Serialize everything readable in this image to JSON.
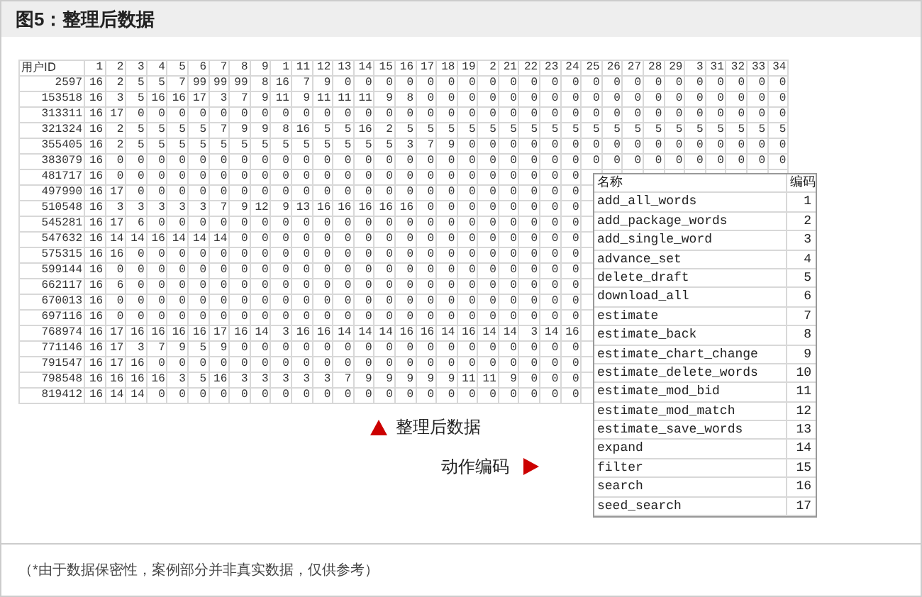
{
  "figure": {
    "title": "图5：整理后数据"
  },
  "table": {
    "columns": [
      "用户ID",
      "1",
      "2",
      "3",
      "4",
      "5",
      "6",
      "7",
      "8",
      "9",
      "1",
      "11",
      "12",
      "13",
      "14",
      "15",
      "16",
      "17",
      "18",
      "19",
      "2",
      "21",
      "22",
      "23",
      "24",
      "25",
      "26",
      "27",
      "28",
      "29",
      "3",
      "31",
      "32",
      "33",
      "34"
    ],
    "rows": [
      {
        "id": "2597",
        "values": [
          "16",
          "2",
          "5",
          "5",
          "7",
          "99",
          "99",
          "99",
          "8",
          "16",
          "7",
          "9",
          "0",
          "0",
          "0",
          "0",
          "0",
          "0",
          "0",
          "0",
          "0",
          "0",
          "0",
          "0",
          "0",
          "0",
          "0",
          "0",
          "0",
          "0",
          "0",
          "0",
          "0",
          "0"
        ]
      },
      {
        "id": "153518",
        "values": [
          "16",
          "3",
          "5",
          "16",
          "16",
          "17",
          "3",
          "7",
          "9",
          "11",
          "9",
          "11",
          "11",
          "11",
          "9",
          "8",
          "0",
          "0",
          "0",
          "0",
          "0",
          "0",
          "0",
          "0",
          "0",
          "0",
          "0",
          "0",
          "0",
          "0",
          "0",
          "0",
          "0",
          "0"
        ]
      },
      {
        "id": "313311",
        "values": [
          "16",
          "17",
          "0",
          "0",
          "0",
          "0",
          "0",
          "0",
          "0",
          "0",
          "0",
          "0",
          "0",
          "0",
          "0",
          "0",
          "0",
          "0",
          "0",
          "0",
          "0",
          "0",
          "0",
          "0",
          "0",
          "0",
          "0",
          "0",
          "0",
          "0",
          "0",
          "0",
          "0",
          "0"
        ]
      },
      {
        "id": "321324",
        "values": [
          "16",
          "2",
          "5",
          "5",
          "5",
          "5",
          "7",
          "9",
          "9",
          "8",
          "16",
          "5",
          "5",
          "16",
          "2",
          "5",
          "5",
          "5",
          "5",
          "5",
          "5",
          "5",
          "5",
          "5",
          "5",
          "5",
          "5",
          "5",
          "5",
          "5",
          "5",
          "5",
          "5",
          "5"
        ]
      },
      {
        "id": "355405",
        "values": [
          "16",
          "2",
          "5",
          "5",
          "5",
          "5",
          "5",
          "5",
          "5",
          "5",
          "5",
          "5",
          "5",
          "5",
          "5",
          "3",
          "7",
          "9",
          "0",
          "0",
          "0",
          "0",
          "0",
          "0",
          "0",
          "0",
          "0",
          "0",
          "0",
          "0",
          "0",
          "0",
          "0",
          "0"
        ]
      },
      {
        "id": "383079",
        "values": [
          "16",
          "0",
          "0",
          "0",
          "0",
          "0",
          "0",
          "0",
          "0",
          "0",
          "0",
          "0",
          "0",
          "0",
          "0",
          "0",
          "0",
          "0",
          "0",
          "0",
          "0",
          "0",
          "0",
          "0",
          "0",
          "0",
          "0",
          "0",
          "0",
          "0",
          "0",
          "0",
          "0",
          "0"
        ]
      },
      {
        "id": "481717",
        "values": [
          "16",
          "0",
          "0",
          "0",
          "0",
          "0",
          "0",
          "0",
          "0",
          "0",
          "0",
          "0",
          "0",
          "0",
          "0",
          "0",
          "0",
          "0",
          "0",
          "0",
          "0",
          "0",
          "0",
          "0"
        ]
      },
      {
        "id": "497990",
        "values": [
          "16",
          "17",
          "0",
          "0",
          "0",
          "0",
          "0",
          "0",
          "0",
          "0",
          "0",
          "0",
          "0",
          "0",
          "0",
          "0",
          "0",
          "0",
          "0",
          "0",
          "0",
          "0",
          "0",
          "0"
        ]
      },
      {
        "id": "510548",
        "values": [
          "16",
          "3",
          "3",
          "3",
          "3",
          "3",
          "7",
          "9",
          "12",
          "9",
          "13",
          "16",
          "16",
          "16",
          "16",
          "16",
          "0",
          "0",
          "0",
          "0",
          "0",
          "0",
          "0",
          "0"
        ]
      },
      {
        "id": "545281",
        "values": [
          "16",
          "17",
          "6",
          "0",
          "0",
          "0",
          "0",
          "0",
          "0",
          "0",
          "0",
          "0",
          "0",
          "0",
          "0",
          "0",
          "0",
          "0",
          "0",
          "0",
          "0",
          "0",
          "0",
          "0"
        ]
      },
      {
        "id": "547632",
        "values": [
          "16",
          "14",
          "14",
          "16",
          "14",
          "14",
          "14",
          "0",
          "0",
          "0",
          "0",
          "0",
          "0",
          "0",
          "0",
          "0",
          "0",
          "0",
          "0",
          "0",
          "0",
          "0",
          "0",
          "0"
        ]
      },
      {
        "id": "575315",
        "values": [
          "16",
          "16",
          "0",
          "0",
          "0",
          "0",
          "0",
          "0",
          "0",
          "0",
          "0",
          "0",
          "0",
          "0",
          "0",
          "0",
          "0",
          "0",
          "0",
          "0",
          "0",
          "0",
          "0",
          "0"
        ]
      },
      {
        "id": "599144",
        "values": [
          "16",
          "0",
          "0",
          "0",
          "0",
          "0",
          "0",
          "0",
          "0",
          "0",
          "0",
          "0",
          "0",
          "0",
          "0",
          "0",
          "0",
          "0",
          "0",
          "0",
          "0",
          "0",
          "0",
          "0"
        ]
      },
      {
        "id": "662117",
        "values": [
          "16",
          "6",
          "0",
          "0",
          "0",
          "0",
          "0",
          "0",
          "0",
          "0",
          "0",
          "0",
          "0",
          "0",
          "0",
          "0",
          "0",
          "0",
          "0",
          "0",
          "0",
          "0",
          "0",
          "0"
        ]
      },
      {
        "id": "670013",
        "values": [
          "16",
          "0",
          "0",
          "0",
          "0",
          "0",
          "0",
          "0",
          "0",
          "0",
          "0",
          "0",
          "0",
          "0",
          "0",
          "0",
          "0",
          "0",
          "0",
          "0",
          "0",
          "0",
          "0",
          "0"
        ]
      },
      {
        "id": "697116",
        "values": [
          "16",
          "0",
          "0",
          "0",
          "0",
          "0",
          "0",
          "0",
          "0",
          "0",
          "0",
          "0",
          "0",
          "0",
          "0",
          "0",
          "0",
          "0",
          "0",
          "0",
          "0",
          "0",
          "0",
          "0"
        ]
      },
      {
        "id": "768974",
        "values": [
          "16",
          "17",
          "16",
          "16",
          "16",
          "16",
          "17",
          "16",
          "14",
          "3",
          "16",
          "16",
          "14",
          "14",
          "14",
          "16",
          "16",
          "14",
          "16",
          "14",
          "14",
          "3",
          "14",
          "16"
        ]
      },
      {
        "id": "771146",
        "values": [
          "16",
          "17",
          "3",
          "7",
          "9",
          "5",
          "9",
          "0",
          "0",
          "0",
          "0",
          "0",
          "0",
          "0",
          "0",
          "0",
          "0",
          "0",
          "0",
          "0",
          "0",
          "0",
          "0",
          "0"
        ]
      },
      {
        "id": "791547",
        "values": [
          "16",
          "17",
          "16",
          "0",
          "0",
          "0",
          "0",
          "0",
          "0",
          "0",
          "0",
          "0",
          "0",
          "0",
          "0",
          "0",
          "0",
          "0",
          "0",
          "0",
          "0",
          "0",
          "0",
          "0"
        ]
      },
      {
        "id": "798548",
        "values": [
          "16",
          "16",
          "16",
          "16",
          "3",
          "5",
          "16",
          "3",
          "3",
          "3",
          "3",
          "3",
          "7",
          "9",
          "9",
          "9",
          "9",
          "9",
          "11",
          "11",
          "9",
          "0",
          "0",
          "0"
        ]
      },
      {
        "id": "819412",
        "values": [
          "16",
          "14",
          "14",
          "0",
          "0",
          "0",
          "0",
          "0",
          "0",
          "0",
          "0",
          "0",
          "0",
          "0",
          "0",
          "0",
          "0",
          "0",
          "0",
          "0",
          "0",
          "0",
          "0",
          "0"
        ]
      }
    ]
  },
  "action_codes": {
    "columns": [
      "名称",
      "编码"
    ],
    "rows": [
      {
        "name": "add_all_words",
        "code": "1"
      },
      {
        "name": "add_package_words",
        "code": "2"
      },
      {
        "name": "add_single_word",
        "code": "3"
      },
      {
        "name": "advance_set",
        "code": "4"
      },
      {
        "name": "delete_draft",
        "code": "5"
      },
      {
        "name": "download_all",
        "code": "6"
      },
      {
        "name": "estimate",
        "code": "7"
      },
      {
        "name": "estimate_back",
        "code": "8"
      },
      {
        "name": "estimate_chart_change",
        "code": "9"
      },
      {
        "name": "estimate_delete_words",
        "code": "10"
      },
      {
        "name": "estimate_mod_bid",
        "code": "11"
      },
      {
        "name": "estimate_mod_match",
        "code": "12"
      },
      {
        "name": "estimate_save_words",
        "code": "13"
      },
      {
        "name": "expand",
        "code": "14"
      },
      {
        "name": "filter",
        "code": "15"
      },
      {
        "name": "search",
        "code": "16"
      },
      {
        "name": "seed_search",
        "code": "17"
      }
    ]
  },
  "labels": [
    {
      "text": "整理后数据",
      "kind": "up"
    },
    {
      "text": "动作编码",
      "kind": "right"
    }
  ],
  "footnote": "（*由于数据保密性，案例部分并非真实数据，仅供参考）"
}
